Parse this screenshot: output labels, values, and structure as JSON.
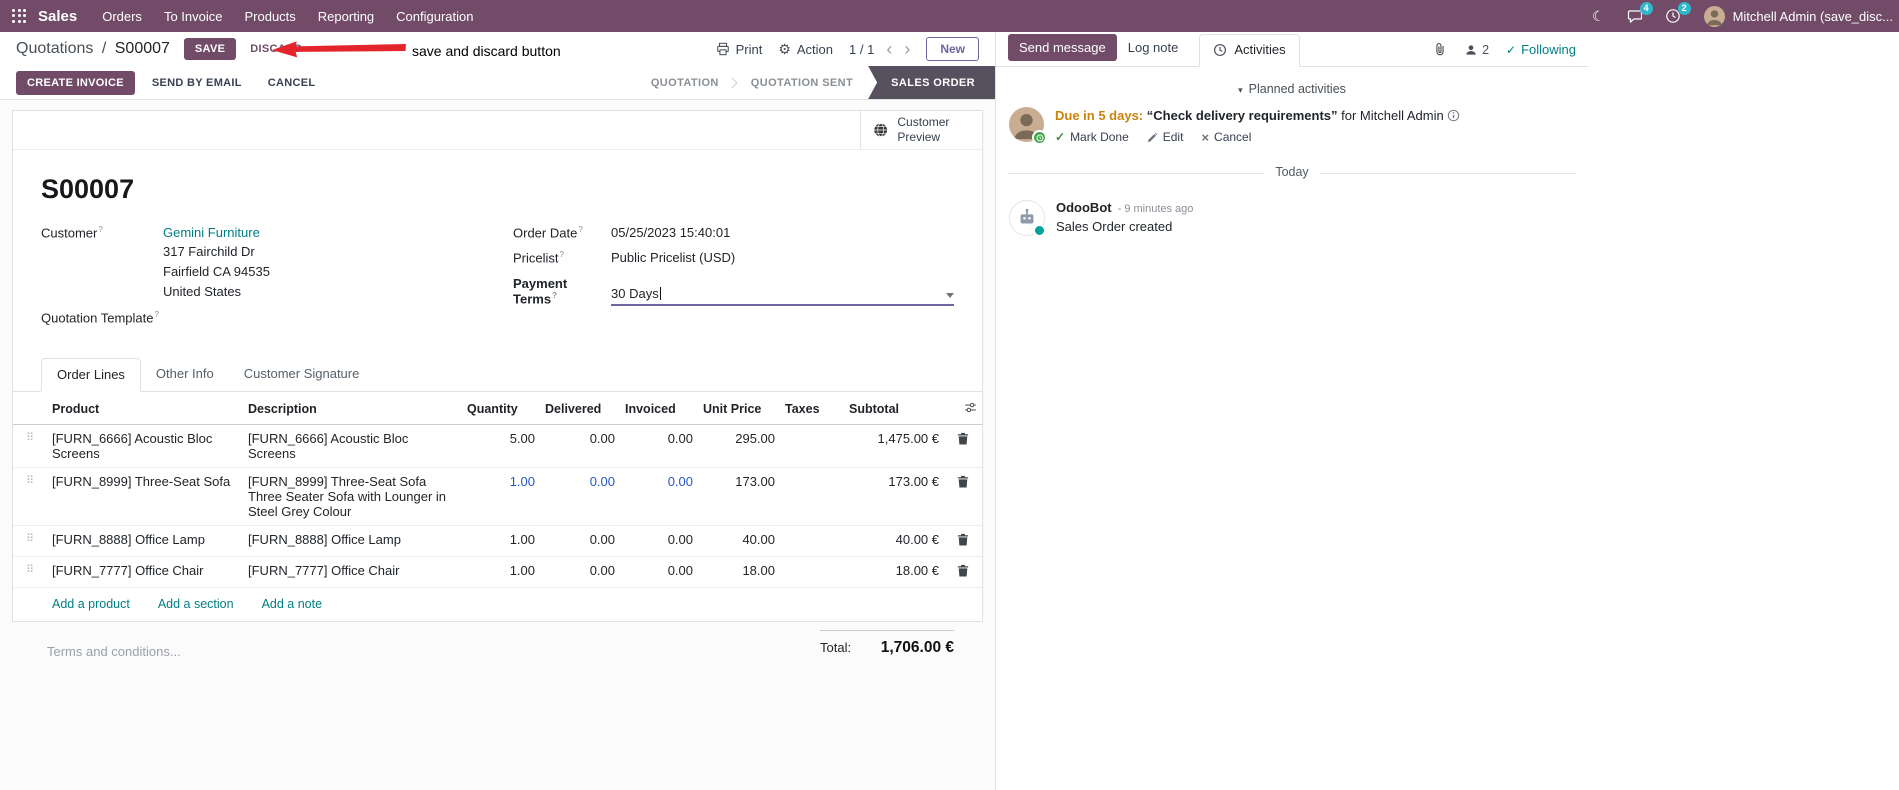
{
  "colors": {
    "brand_primary": "#714B67",
    "accent_indigo": "#71639e",
    "link_teal": "#017e84",
    "modified_value_blue": "#2757C4",
    "statusbar_active_bg": "#57515F",
    "activity_due_orange": "#C9830B",
    "navbar_badge_teal": "#2FB8CC",
    "success_green": "#41A64B",
    "annotation_red": "#E3242B"
  },
  "icons": {
    "gear": "⚙",
    "moon": "☾",
    "check": "✓",
    "handle": "⠿",
    "chevron_left": "‹",
    "chevron_right": "›",
    "caret_collapse": "▾",
    "multiply": "×"
  },
  "navbar": {
    "app_name": "Sales",
    "menus": [
      "Orders",
      "To Invoice",
      "Products",
      "Reporting",
      "Configuration"
    ],
    "messages_badge": "4",
    "activities_badge": "2",
    "user_name": "Mitchell Admin (save_disc..."
  },
  "control_panel": {
    "breadcrumb": {
      "parent": "Quotations",
      "separator": "/",
      "current": "S00007"
    },
    "save_label": "SAVE",
    "discard_label": "DISCARD",
    "print_label": "Print",
    "action_label": "Action",
    "pager_value": "1 / 1",
    "new_label": "New"
  },
  "annotation": {
    "text": "save and discard button"
  },
  "statusbar": {
    "create_invoice": "CREATE INVOICE",
    "send_by_email": "SEND BY EMAIL",
    "cancel": "CANCEL",
    "steps": [
      {
        "label": "QUOTATION"
      },
      {
        "label": "QUOTATION SENT"
      },
      {
        "label": "SALES ORDER"
      }
    ]
  },
  "sheet": {
    "customer_preview_label": "Customer Preview",
    "title": "S00007",
    "help_marker": "?",
    "customer_label": "Customer",
    "customer_name": "Gemini Furniture",
    "customer_address": [
      "317 Fairchild Dr",
      "Fairfield CA 94535",
      "United States"
    ],
    "order_date_label": "Order Date",
    "order_date_value": "05/25/2023 15:40:01",
    "pricelist_label": "Pricelist",
    "pricelist_value": "Public Pricelist (USD)",
    "payment_terms_label": "Payment Terms",
    "payment_terms_value": "30 Days",
    "quotation_template_label": "Quotation Template",
    "tabs": [
      {
        "label": "Order Lines"
      },
      {
        "label": "Other Info"
      },
      {
        "label": "Customer Signature"
      }
    ],
    "columns": {
      "product": "Product",
      "description": "Description",
      "quantity": "Quantity",
      "delivered": "Delivered",
      "invoiced": "Invoiced",
      "unit_price": "Unit Price",
      "taxes": "Taxes",
      "subtotal": "Subtotal"
    },
    "rows": [
      {
        "product": "[FURN_6666] Acoustic Bloc Screens",
        "description": "[FURN_6666] Acoustic Bloc Screens",
        "description2": "",
        "quantity": "5.00",
        "delivered": "0.00",
        "invoiced": "0.00",
        "unit_price": "295.00",
        "taxes": "",
        "subtotal": "1,475.00 €"
      },
      {
        "product": "[FURN_8999] Three-Seat Sofa",
        "description": "[FURN_8999] Three-Seat Sofa",
        "description2": "Three Seater Sofa with Lounger in Steel Grey Colour",
        "quantity": "1.00",
        "delivered": "0.00",
        "invoiced": "0.00",
        "unit_price": "173.00",
        "taxes": "",
        "subtotal": "173.00 €"
      },
      {
        "product": "[FURN_8888] Office Lamp",
        "description": "[FURN_8888] Office Lamp",
        "description2": "",
        "quantity": "1.00",
        "delivered": "0.00",
        "invoiced": "0.00",
        "unit_price": "40.00",
        "taxes": "",
        "subtotal": "40.00 €"
      },
      {
        "product": "[FURN_7777] Office Chair",
        "description": "[FURN_7777] Office Chair",
        "description2": "",
        "quantity": "1.00",
        "delivered": "0.00",
        "invoiced": "0.00",
        "unit_price": "18.00",
        "taxes": "",
        "subtotal": "18.00 €"
      }
    ],
    "footer_links": [
      "Add a product",
      "Add a section",
      "Add a note"
    ],
    "terms_placeholder": "Terms and conditions...",
    "total_label": "Total:",
    "total_value": "1,706.00 €"
  },
  "chatter": {
    "send_message": "Send message",
    "log_note": "Log note",
    "activities_label": "Activities",
    "followers_count": "2",
    "following_label": "Following",
    "planned_header": "Planned activities",
    "activity": {
      "due": "Due in 5 days:",
      "summary": "“Check delivery requirements”",
      "for_user": "for Mitchell Admin",
      "mark_done": "Mark Done",
      "edit": "Edit",
      "cancel": "Cancel"
    },
    "date_divider": "Today",
    "message": {
      "author": "OdooBot",
      "time": "- 9 minutes ago",
      "body": "Sales Order created"
    }
  }
}
